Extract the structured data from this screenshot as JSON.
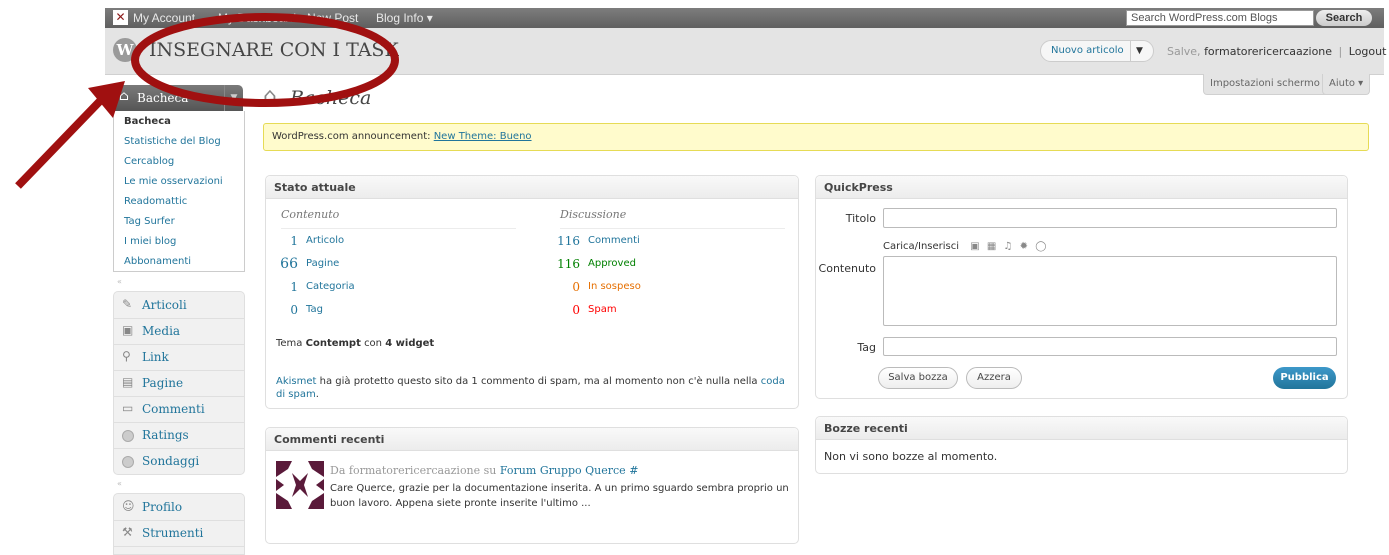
{
  "admin_bar": {
    "items": [
      "My Account",
      "My Dashboard",
      "New Post",
      "Blog Info ▾"
    ],
    "search_placeholder": "Search WordPress.com Blogs",
    "search_button": "Search"
  },
  "header": {
    "wp_logo": "W",
    "site_title": "INSEGNARE CON I TASK",
    "new_post_button": "Nuovo articolo",
    "greeting": "Salve,",
    "username": "formatorericercaazione",
    "separator": "|",
    "logout": "Logout"
  },
  "screen_tabs": {
    "screen_options": "Impostazioni schermo ▾",
    "help": "Aiuto ▾"
  },
  "sidebar": {
    "home_label": "Bacheca",
    "home_submenu": [
      "Bacheca",
      "Statistiche del Blog",
      "Cercablog",
      "Le mie osservazioni",
      "Readomattic",
      "Tag Surfer",
      "I miei blog",
      "Abbonamenti"
    ],
    "menu_group1": [
      {
        "label": "Articoli",
        "icon": "pushpin-icon"
      },
      {
        "label": "Media",
        "icon": "media-icon"
      },
      {
        "label": "Link",
        "icon": "link-icon"
      },
      {
        "label": "Pagine",
        "icon": "pages-icon"
      },
      {
        "label": "Commenti",
        "icon": "comment-icon"
      },
      {
        "label": "Ratings",
        "icon": "ratings-icon"
      },
      {
        "label": "Sondaggi",
        "icon": "polls-icon"
      }
    ],
    "menu_group2": [
      {
        "label": "Profilo",
        "icon": "profile-icon"
      },
      {
        "label": "Strumenti",
        "icon": "tools-icon"
      }
    ]
  },
  "main": {
    "title": "Bacheca",
    "announcement": {
      "prefix": "WordPress.com announcement:",
      "link": "New Theme: Bueno"
    },
    "stato_attuale": {
      "title": "Stato attuale",
      "content_heading": "Contenuto",
      "discussion_heading": "Discussione",
      "content_rows": [
        {
          "count": "1",
          "label": "Articolo"
        },
        {
          "count": "66",
          "label": "Pagine"
        },
        {
          "count": "1",
          "label": "Categoria"
        },
        {
          "count": "0",
          "label": "Tag"
        }
      ],
      "discussion_rows": [
        {
          "count": "116",
          "label": "Commenti",
          "color": "#21759b"
        },
        {
          "count": "116",
          "label": "Approved",
          "color": "#008000"
        },
        {
          "count": "0",
          "label": "In sospeso",
          "color": "#e66f00"
        },
        {
          "count": "0",
          "label": "Spam",
          "color": "#ff0000"
        }
      ],
      "theme_prefix": "Tema",
      "theme_name": "Contempt",
      "theme_mid": "con",
      "widgets": "4 widget",
      "akismet_link": "Akismet",
      "akismet_text": "ha già protetto questo sito da 1 commento di spam, ma al momento non c'è nulla nella",
      "akismet_queue_link": "coda di spam",
      "akismet_end": "."
    },
    "commenti_recenti": {
      "title": "Commenti recenti",
      "author_prefix": "Da",
      "author": "formatorericercaazione",
      "on": "su",
      "post": "Forum Gruppo Querce",
      "hash": "#",
      "text_line1": "Care Querce, grazie per la documentazione inserita. A un primo sguardo sembra proprio un",
      "text_line2": "buon lavoro. Appena siete pronte inserite l'ultimo ..."
    },
    "quickpress": {
      "title": "QuickPress",
      "title_label": "Titolo",
      "upload_label": "Carica/Inserisci",
      "content_label": "Contenuto",
      "tag_label": "Tag",
      "save_draft": "Salva bozza",
      "reset": "Azzera",
      "publish": "Pubblica"
    },
    "bozze_recenti": {
      "title": "Bozze recenti",
      "empty": "Non vi sono bozze al momento."
    }
  },
  "colors": {
    "link": "#21759b",
    "annotation": "#a01010"
  }
}
